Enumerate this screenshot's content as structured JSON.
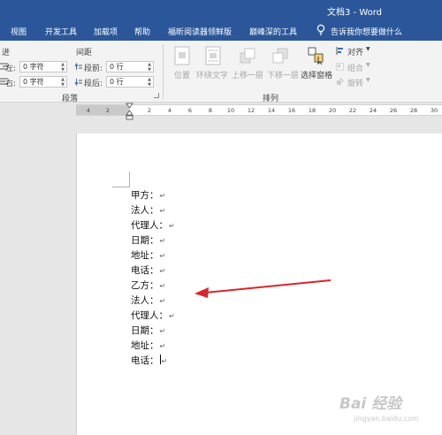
{
  "window": {
    "title": "文档3 - Word"
  },
  "tabs": [
    "视图",
    "开发工具",
    "加载项",
    "帮助",
    "福昕阅读器领鲜版",
    "巅峰深的工具"
  ],
  "tell_me": "告诉我你想要做什么",
  "ribbon": {
    "paragraph": {
      "indent_header": "进",
      "spacing_header": "间距",
      "left_label": "左:",
      "right_label": "右:",
      "before_label": "段前:",
      "after_label": "段后:",
      "left_value": "0 字符",
      "right_value": "0 字符",
      "before_value": "0 行",
      "after_value": "0 行",
      "group_label": "段落"
    },
    "arrange": {
      "position": "位置",
      "wrap_text": "环绕文字",
      "bring_forward": "上移一层",
      "send_backward": "下移一层",
      "selection_pane": "选择窗格",
      "align": "对齐",
      "group": "组合",
      "rotate": "旋转",
      "group_label": "排列"
    }
  },
  "ruler": {
    "left_ticks": [
      "4",
      "2"
    ],
    "ticks": [
      "2",
      "4",
      "6",
      "8",
      "10",
      "12",
      "14",
      "16",
      "18",
      "20",
      "22",
      "24",
      "26",
      "28",
      "30"
    ]
  },
  "document": {
    "lines": [
      "甲方：",
      "法人：",
      "代理人：",
      "日期：",
      "地址：",
      "电话：",
      "乙方：",
      "法人：",
      "代理人：",
      "日期：",
      "地址：",
      "电话："
    ],
    "paragraph_mark": "↵"
  },
  "watermark": {
    "text": "Bai 经验",
    "url": "jingyan.baidu.com"
  },
  "colors": {
    "title_bar": "#2b579a",
    "ribbon": "#f3f3f3",
    "workspace": "#e6e6e6",
    "arrow": "#d9262b"
  }
}
